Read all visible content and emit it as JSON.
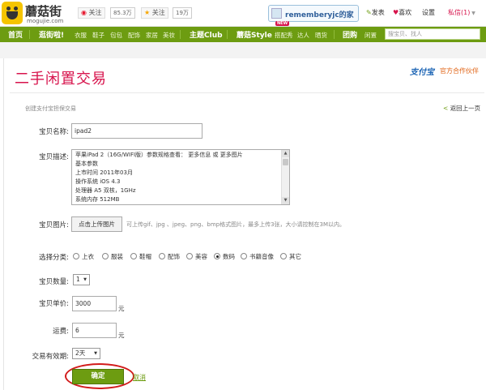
{
  "header": {
    "brand": "蘑菇街",
    "brand_url": "mogujie.com",
    "weibo_follow": "关注",
    "weibo_count": "85.3万",
    "star_follow": "关注",
    "star_count": "19万",
    "home_name": "rememberyjc的家",
    "post": "发表",
    "likes": "喜欢",
    "settings": "设置",
    "messages": "私信(1)"
  },
  "nav": {
    "home": "首页",
    "shop": "逛街啦!",
    "clothes": "衣服",
    "shoes": "鞋子",
    "bags": "包包",
    "accessories": "配饰",
    "home_goods": "家居",
    "beauty": "美妆",
    "club": "主题Club",
    "style": "蘑菇Style",
    "match": "搭配秀",
    "expert": "达人",
    "show": "晒货",
    "group": "团购",
    "idle": "闲置",
    "new_badge": "NEW",
    "search_placeholder": "搜宝贝、找人"
  },
  "page": {
    "title": "二手闲置交易",
    "alipay": "支付宝",
    "alipay_sub": "官方合作伙伴",
    "crumb": "创建支付宝担保交易",
    "back": "返回上一页",
    "back_arrow": "<"
  },
  "form": {
    "name_label": "宝贝名称:",
    "name_value": "ipad2",
    "desc_label": "宝贝描述:",
    "desc_lines": [
      "苹果iPad 2（16G/WIFI版）参数规格查看：  更多信息  或  更多图片",
      "基本参数",
      "上市时间  2011年03月",
      "操作系统  iOS 4.3",
      "处理器  A5 双核，1GHz",
      "系统内存  512MB"
    ],
    "pic_label": "宝贝图片:",
    "upload_label": "点击上传图片",
    "upload_hint": "可上传gif、jpg 、jpeg、png、bmp格式图片，最多上传3张，大小请控制在3M以内。",
    "category_label": "选择分类:",
    "categories": [
      "上衣",
      "服装",
      "鞋帽",
      "配饰",
      "美容",
      "数码",
      "书籍音像",
      "其它"
    ],
    "category_selected": 5,
    "qty_label": "宝贝数量:",
    "qty_value": "1",
    "price_label": "宝贝单价:",
    "price_value": "3000",
    "price_unit": "元",
    "shipping_label": "运费:",
    "shipping_value": "6",
    "shipping_unit": "元",
    "valid_label": "交易有效期:",
    "valid_value": "2天",
    "confirm": "确定",
    "cancel": "取消"
  },
  "colors": {
    "nav_green": "#6d9c11",
    "title_red": "#d7134c",
    "highlight_red": "#d21b1b"
  }
}
